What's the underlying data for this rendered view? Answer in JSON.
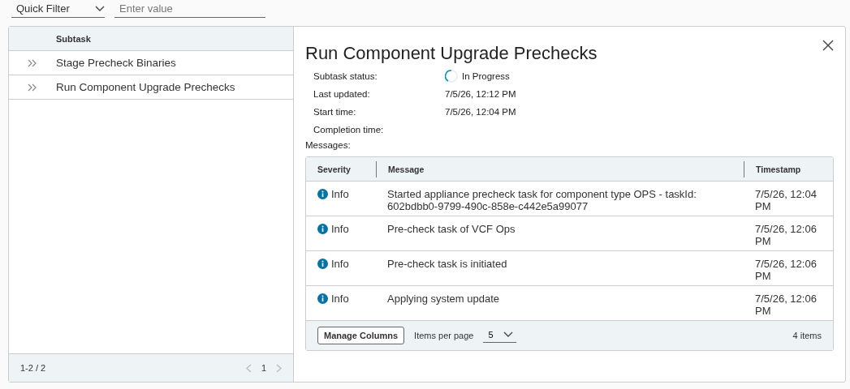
{
  "filter": {
    "select": "Quick Filter",
    "placeholder": "Enter value"
  },
  "subtasks": {
    "column": "Subtask",
    "rows": [
      "Stage Precheck Binaries",
      "Run Component Upgrade Prechecks"
    ],
    "footer": "1-2 / 2",
    "page": "1"
  },
  "detail": {
    "title": "Run Component Upgrade Prechecks",
    "fields": [
      {
        "label": "Subtask status:",
        "value": "In Progress",
        "kind": "status"
      },
      {
        "label": "Last updated:",
        "value": "7/5/26, 12:12 PM",
        "kind": "text"
      },
      {
        "label": "Start time:",
        "value": "7/5/26, 12:04 PM",
        "kind": "text"
      },
      {
        "label": "Completion time:",
        "kind": "text"
      }
    ],
    "messages_label": "Messages:",
    "messages": {
      "columns": [
        "Severity",
        "Message",
        "Timestamp"
      ],
      "rows": [
        {
          "severity": "Info",
          "message": "Started appliance precheck task for component type OPS - taskId: 602bdbb0-9799-490c-858e-c442e5a99077",
          "timestamp": "7/5/26, 12:04 PM"
        },
        {
          "severity": "Info",
          "message": "Pre-check task of VCF Ops",
          "timestamp": "7/5/26, 12:06 PM"
        },
        {
          "severity": "Info",
          "message": "Pre-check task is initiated",
          "timestamp": "7/5/26, 12:06 PM"
        },
        {
          "severity": "Info",
          "message": "Applying system update",
          "timestamp": "7/5/26, 12:06 PM"
        }
      ],
      "manage": "Manage Columns",
      "per_page_label": "Items per page",
      "per_page": "5",
      "count": "4 items"
    }
  }
}
